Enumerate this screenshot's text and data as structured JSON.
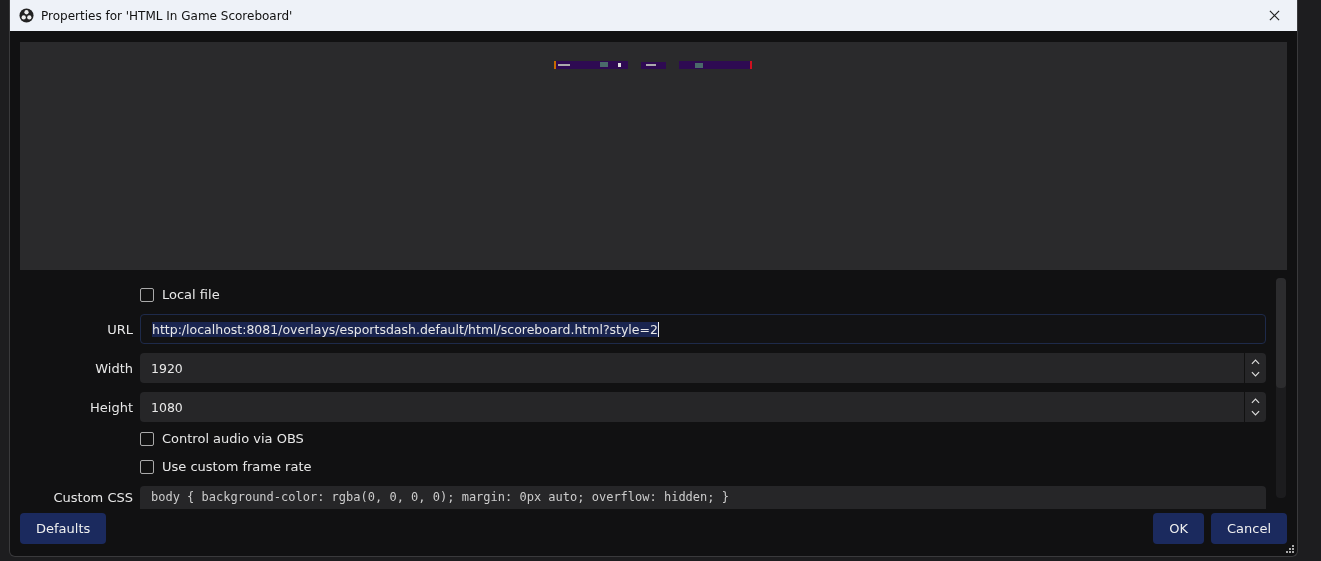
{
  "window": {
    "title": "Properties for 'HTML In Game Scoreboard'"
  },
  "preview": {
    "kind": "scoreboard"
  },
  "properties": [
    {
      "kind": "checkbox",
      "label": "Local file",
      "checked": false
    },
    {
      "kind": "text",
      "label": "URL",
      "value": "http:/localhost:8081/overlays/esportsdash.default/html/scoreboard.html?style=2",
      "selected": true
    },
    {
      "kind": "spin",
      "label": "Width",
      "value": "1920"
    },
    {
      "kind": "spin",
      "label": "Height",
      "value": "1080"
    },
    {
      "kind": "checkbox",
      "label": "Control audio via OBS",
      "checked": false
    },
    {
      "kind": "checkbox",
      "label": "Use custom frame rate",
      "checked": false
    },
    {
      "kind": "code",
      "label": "Custom CSS",
      "value": "body { background-color: rgba(0, 0, 0, 0); margin: 0px auto; overflow: hidden; }"
    }
  ],
  "buttons": {
    "left": [
      "Defaults"
    ],
    "right": [
      "OK",
      "Cancel"
    ]
  }
}
